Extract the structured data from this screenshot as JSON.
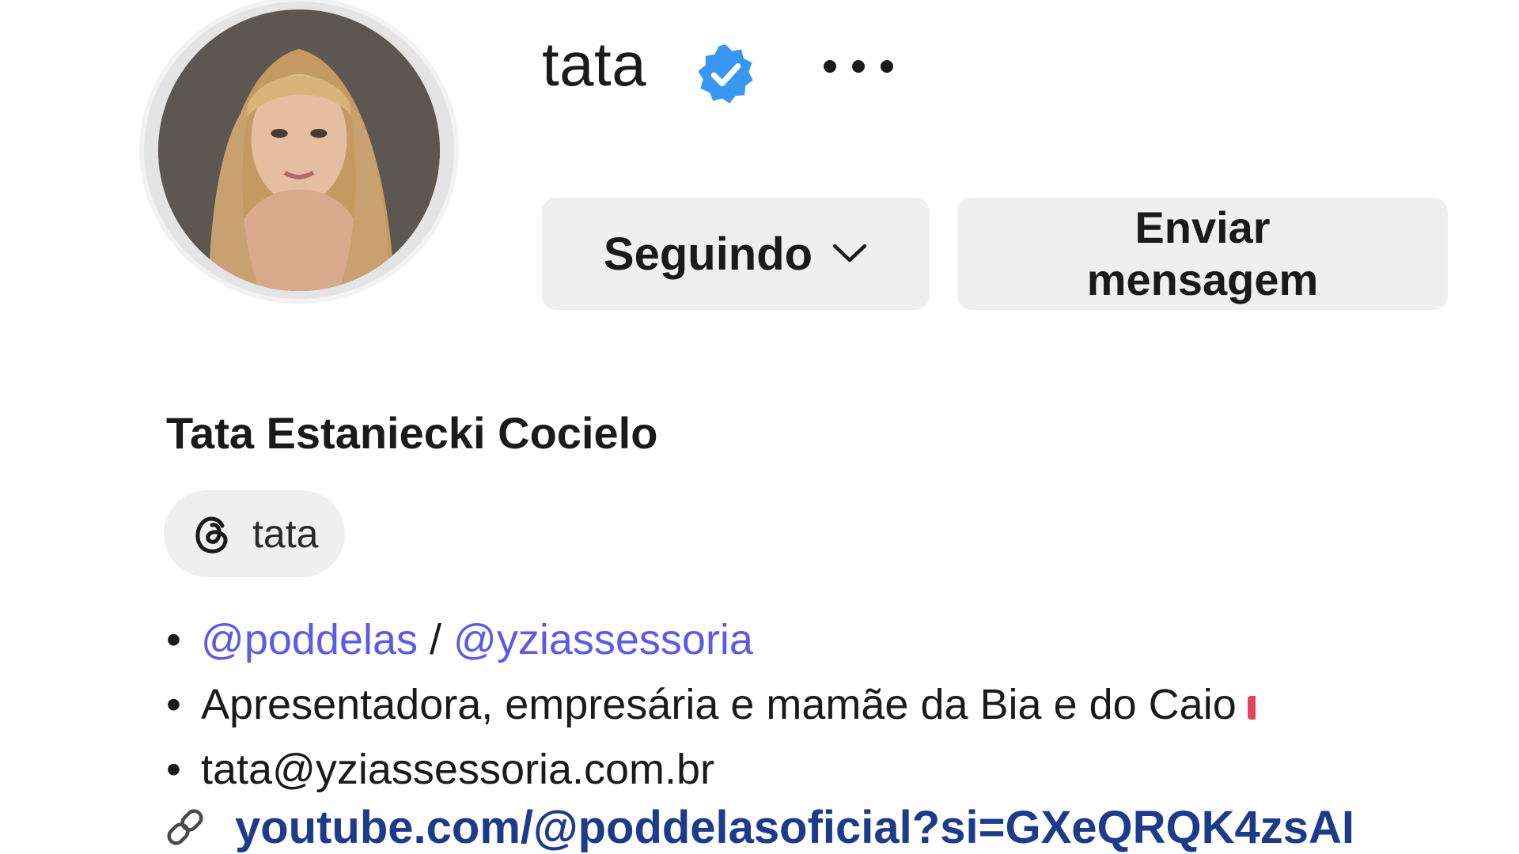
{
  "profile": {
    "username": "tata",
    "verified": true,
    "full_name": "Tata Estaniecki Cocielo",
    "avatar": "profile-photo",
    "more_icon": "more-horizontal-icon"
  },
  "actions": {
    "following_label": "Seguindo",
    "following_icon": "chevron-down-icon",
    "message_label_line1": "Enviar",
    "message_label_line2": "mensagem"
  },
  "threads": {
    "icon": "threads-icon",
    "label": "tata"
  },
  "bio": {
    "line1": {
      "bullet": "•",
      "mention1": "@poddelas",
      "separator": " / ",
      "mention2": "@yziassessoria"
    },
    "line2": {
      "bullet": "•",
      "text": "Apresentadora, empresária e mamãe da Bia e do Caio"
    },
    "line3": {
      "bullet": "•",
      "text": "tata@yziassessoria.com.br"
    }
  },
  "link": {
    "icon": "link-icon",
    "text": "youtube.com/@poddelasoficial?si=GXeQRQK4zsAI"
  },
  "colors": {
    "verified_badge": "#3897f0",
    "mention": "#5b5be8",
    "link": "#1d3b8a",
    "button_bg": "#efefef"
  }
}
